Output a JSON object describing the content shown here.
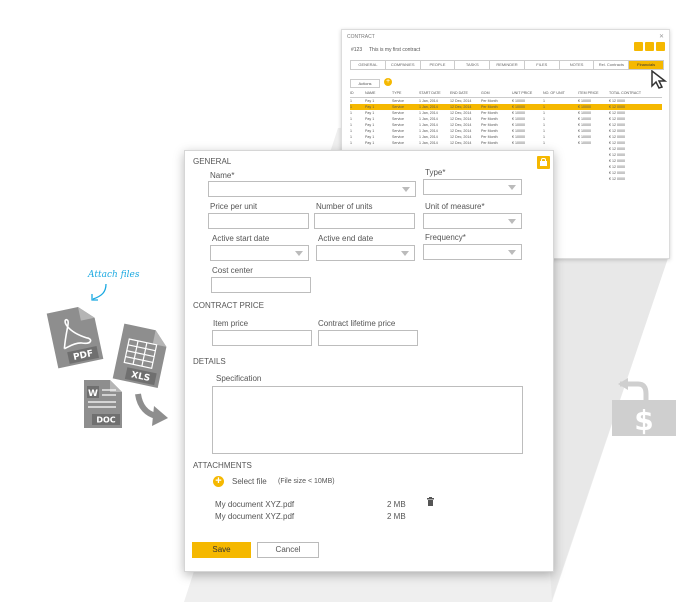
{
  "contract": {
    "window_title": "CONTRACT",
    "id": "#123",
    "name": "This is my first contract",
    "tabs": [
      {
        "label": "GENERAL",
        "active": false
      },
      {
        "label": "COMPANIES",
        "active": false
      },
      {
        "label": "PEOPLE",
        "active": false
      },
      {
        "label": "TASKS",
        "active": false
      },
      {
        "label": "REMINDER",
        "active": false
      },
      {
        "label": "FILES",
        "active": false
      },
      {
        "label": "NOTES",
        "active": false
      },
      {
        "label": "Rel. Contracts",
        "active": false
      },
      {
        "label": "Financials",
        "active": true
      }
    ],
    "actions_label": "Actions",
    "columns": [
      "ID",
      "NAME",
      "TYPE",
      "START DATE",
      "END DATE",
      "GOM",
      "UNIT PRICE",
      "NO. OF UNIT",
      "ITEM PRICE",
      "TOTAL CONTRACT"
    ],
    "rows": [
      [
        "1",
        "Pay 1",
        "Service",
        "1 Jan, 2014",
        "12 Dec, 2014",
        "Per Month",
        "€ 10000",
        "1",
        "€ 10000",
        "€ 12 0000"
      ],
      [
        "1",
        "Pay 1",
        "Service",
        "1 Jan, 2014",
        "12 Dec, 2014",
        "Per Month",
        "€ 10000",
        "1",
        "€ 10000",
        "€ 12 0000"
      ],
      [
        "1",
        "Pay 1",
        "Service",
        "1 Jan, 2014",
        "12 Dec, 2014",
        "Per Month",
        "€ 10000",
        "1",
        "€ 10000",
        "€ 12 0000"
      ],
      [
        "1",
        "Pay 1",
        "Service",
        "1 Jan, 2014",
        "12 Dec, 2014",
        "Per Month",
        "€ 10000",
        "1",
        "€ 10000",
        "€ 12 0000"
      ],
      [
        "1",
        "Pay 1",
        "Service",
        "1 Jan, 2014",
        "12 Dec, 2014",
        "Per Month",
        "€ 10000",
        "1",
        "€ 10000",
        "€ 12 0000"
      ],
      [
        "1",
        "Pay 1",
        "Service",
        "1 Jan, 2014",
        "12 Dec, 2014",
        "Per Month",
        "€ 10000",
        "1",
        "€ 10000",
        "€ 12 0000"
      ],
      [
        "1",
        "Pay 1",
        "Service",
        "1 Jan, 2014",
        "12 Dec, 2014",
        "Per Month",
        "€ 10000",
        "1",
        "€ 10000",
        "€ 12 0000"
      ],
      [
        "1",
        "Pay 1",
        "Service",
        "1 Jan, 2014",
        "12 Dec, 2014",
        "Per Month",
        "€ 10000",
        "1",
        "€ 10000",
        "€ 12 0000"
      ],
      [
        "",
        "",
        "",
        "",
        "",
        "",
        "",
        "",
        "",
        "€ 12 0000"
      ],
      [
        "",
        "",
        "",
        "",
        "",
        "",
        "",
        "",
        "",
        "€ 12 0000"
      ],
      [
        "",
        "",
        "",
        "",
        "",
        "",
        "",
        "",
        "",
        "€ 12 0000"
      ],
      [
        "",
        "",
        "",
        "",
        "",
        "",
        "",
        "",
        "",
        "€ 12 0000"
      ],
      [
        "",
        "",
        "",
        "",
        "",
        "",
        "",
        "",
        "",
        "€ 12 0000"
      ],
      [
        "",
        "",
        "",
        "",
        "",
        "",
        "",
        "",
        "",
        "€ 12 0000"
      ]
    ],
    "selected_row": 1
  },
  "form": {
    "general_title": "GENERAL",
    "name_label": "Name*",
    "type_label": "Type*",
    "price_per_unit_label": "Price per unit",
    "number_of_units_label": "Number of units",
    "unit_of_measure_label": "Unit of measure*",
    "active_start_label": "Active start date",
    "active_end_label": "Active end date",
    "frequency_label": "Frequency*",
    "cost_center_label": "Cost center",
    "contract_price_title": "CONTRACT PRICE",
    "item_price_label": "Item price",
    "lifetime_price_label": "Contract lifetime price",
    "details_title": "DETAILS",
    "specification_label": "Specification",
    "attachments_title": "ATTACHMENTS",
    "select_file_label": "Select file",
    "file_size_hint": "(File size < 10MB)",
    "attachments": [
      {
        "name": "My document XYZ.pdf",
        "size": "2 MB"
      },
      {
        "name": "My document XYZ.pdf",
        "size": "2 MB"
      }
    ],
    "save_label": "Save",
    "cancel_label": "Cancel"
  },
  "decor": {
    "attach_files": "Attach files",
    "pdf": "PDF",
    "xls": "XLS",
    "doc": "DOC",
    "dollar": "$"
  },
  "colors": {
    "accent": "#f5b800",
    "link": "#1ba9e1",
    "icon_gray": "#888888"
  }
}
